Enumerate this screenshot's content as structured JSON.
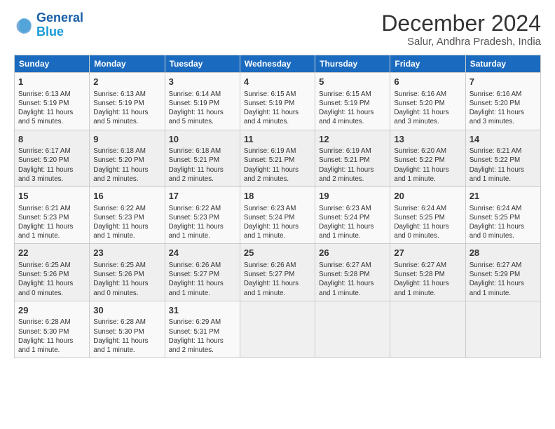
{
  "logo": {
    "line1": "General",
    "line2": "Blue"
  },
  "title": "December 2024",
  "subtitle": "Salur, Andhra Pradesh, India",
  "weekdays": [
    "Sunday",
    "Monday",
    "Tuesday",
    "Wednesday",
    "Thursday",
    "Friday",
    "Saturday"
  ],
  "weeks": [
    [
      {
        "day": "1",
        "text": "Sunrise: 6:13 AM\nSunset: 5:19 PM\nDaylight: 11 hours and 5 minutes."
      },
      {
        "day": "2",
        "text": "Sunrise: 6:13 AM\nSunset: 5:19 PM\nDaylight: 11 hours and 5 minutes."
      },
      {
        "day": "3",
        "text": "Sunrise: 6:14 AM\nSunset: 5:19 PM\nDaylight: 11 hours and 5 minutes."
      },
      {
        "day": "4",
        "text": "Sunrise: 6:15 AM\nSunset: 5:19 PM\nDaylight: 11 hours and 4 minutes."
      },
      {
        "day": "5",
        "text": "Sunrise: 6:15 AM\nSunset: 5:19 PM\nDaylight: 11 hours and 4 minutes."
      },
      {
        "day": "6",
        "text": "Sunrise: 6:16 AM\nSunset: 5:20 PM\nDaylight: 11 hours and 3 minutes."
      },
      {
        "day": "7",
        "text": "Sunrise: 6:16 AM\nSunset: 5:20 PM\nDaylight: 11 hours and 3 minutes."
      }
    ],
    [
      {
        "day": "8",
        "text": "Sunrise: 6:17 AM\nSunset: 5:20 PM\nDaylight: 11 hours and 3 minutes."
      },
      {
        "day": "9",
        "text": "Sunrise: 6:18 AM\nSunset: 5:20 PM\nDaylight: 11 hours and 2 minutes."
      },
      {
        "day": "10",
        "text": "Sunrise: 6:18 AM\nSunset: 5:21 PM\nDaylight: 11 hours and 2 minutes."
      },
      {
        "day": "11",
        "text": "Sunrise: 6:19 AM\nSunset: 5:21 PM\nDaylight: 11 hours and 2 minutes."
      },
      {
        "day": "12",
        "text": "Sunrise: 6:19 AM\nSunset: 5:21 PM\nDaylight: 11 hours and 2 minutes."
      },
      {
        "day": "13",
        "text": "Sunrise: 6:20 AM\nSunset: 5:22 PM\nDaylight: 11 hours and 1 minute."
      },
      {
        "day": "14",
        "text": "Sunrise: 6:21 AM\nSunset: 5:22 PM\nDaylight: 11 hours and 1 minute."
      }
    ],
    [
      {
        "day": "15",
        "text": "Sunrise: 6:21 AM\nSunset: 5:23 PM\nDaylight: 11 hours and 1 minute."
      },
      {
        "day": "16",
        "text": "Sunrise: 6:22 AM\nSunset: 5:23 PM\nDaylight: 11 hours and 1 minute."
      },
      {
        "day": "17",
        "text": "Sunrise: 6:22 AM\nSunset: 5:23 PM\nDaylight: 11 hours and 1 minute."
      },
      {
        "day": "18",
        "text": "Sunrise: 6:23 AM\nSunset: 5:24 PM\nDaylight: 11 hours and 1 minute."
      },
      {
        "day": "19",
        "text": "Sunrise: 6:23 AM\nSunset: 5:24 PM\nDaylight: 11 hours and 1 minute."
      },
      {
        "day": "20",
        "text": "Sunrise: 6:24 AM\nSunset: 5:25 PM\nDaylight: 11 hours and 0 minutes."
      },
      {
        "day": "21",
        "text": "Sunrise: 6:24 AM\nSunset: 5:25 PM\nDaylight: 11 hours and 0 minutes."
      }
    ],
    [
      {
        "day": "22",
        "text": "Sunrise: 6:25 AM\nSunset: 5:26 PM\nDaylight: 11 hours and 0 minutes."
      },
      {
        "day": "23",
        "text": "Sunrise: 6:25 AM\nSunset: 5:26 PM\nDaylight: 11 hours and 0 minutes."
      },
      {
        "day": "24",
        "text": "Sunrise: 6:26 AM\nSunset: 5:27 PM\nDaylight: 11 hours and 1 minute."
      },
      {
        "day": "25",
        "text": "Sunrise: 6:26 AM\nSunset: 5:27 PM\nDaylight: 11 hours and 1 minute."
      },
      {
        "day": "26",
        "text": "Sunrise: 6:27 AM\nSunset: 5:28 PM\nDaylight: 11 hours and 1 minute."
      },
      {
        "day": "27",
        "text": "Sunrise: 6:27 AM\nSunset: 5:28 PM\nDaylight: 11 hours and 1 minute."
      },
      {
        "day": "28",
        "text": "Sunrise: 6:27 AM\nSunset: 5:29 PM\nDaylight: 11 hours and 1 minute."
      }
    ],
    [
      {
        "day": "29",
        "text": "Sunrise: 6:28 AM\nSunset: 5:30 PM\nDaylight: 11 hours and 1 minute."
      },
      {
        "day": "30",
        "text": "Sunrise: 6:28 AM\nSunset: 5:30 PM\nDaylight: 11 hours and 1 minute."
      },
      {
        "day": "31",
        "text": "Sunrise: 6:29 AM\nSunset: 5:31 PM\nDaylight: 11 hours and 2 minutes."
      },
      {
        "day": "",
        "text": ""
      },
      {
        "day": "",
        "text": ""
      },
      {
        "day": "",
        "text": ""
      },
      {
        "day": "",
        "text": ""
      }
    ]
  ]
}
